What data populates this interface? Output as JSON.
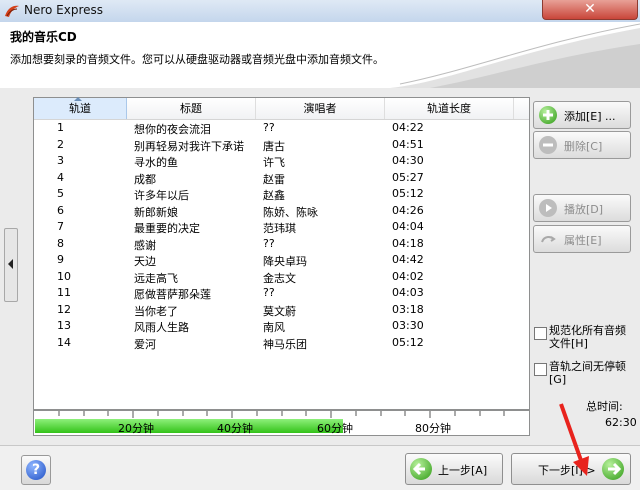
{
  "window": {
    "title": "Nero Express",
    "close_glyph": "✕"
  },
  "header": {
    "title": "我的音乐CD",
    "subtitle": "添加想要刻录的音频文件。您可以从硬盘驱动器或音频光盘中添加音频文件。"
  },
  "track_list": {
    "columns": [
      "轨道",
      "标题",
      "演唱者",
      "轨道长度"
    ],
    "rows": [
      {
        "num": "1",
        "title": "想你的夜会流泪",
        "artist": "??",
        "length": "04:22"
      },
      {
        "num": "2",
        "title": "别再轻易对我许下承诺",
        "artist": "唐古",
        "length": "04:51"
      },
      {
        "num": "3",
        "title": "寻水的鱼",
        "artist": "许飞",
        "length": "04:30"
      },
      {
        "num": "4",
        "title": "成都",
        "artist": "赵雷",
        "length": "05:27"
      },
      {
        "num": "5",
        "title": "许多年以后",
        "artist": "赵鑫",
        "length": "05:12"
      },
      {
        "num": "6",
        "title": "新郎新娘",
        "artist": "陈娇、陈咏",
        "length": "04:26"
      },
      {
        "num": "7",
        "title": "最重要的决定",
        "artist": "范玮琪",
        "length": "04:04"
      },
      {
        "num": "8",
        "title": "感谢",
        "artist": "??",
        "length": "04:18"
      },
      {
        "num": "9",
        "title": "天边",
        "artist": "降央卓玛",
        "length": "04:42"
      },
      {
        "num": "10",
        "title": "远走高飞",
        "artist": "金志文",
        "length": "04:02"
      },
      {
        "num": "11",
        "title": "愿做菩萨那朵莲",
        "artist": "??",
        "length": "04:03"
      },
      {
        "num": "12",
        "title": "当你老了",
        "artist": "莫文蔚",
        "length": "03:18"
      },
      {
        "num": "13",
        "title": "风雨人生路",
        "artist": "南风",
        "length": "03:30"
      },
      {
        "num": "14",
        "title": "爱河",
        "artist": "神马乐团",
        "length": "05:12"
      }
    ]
  },
  "buttons": {
    "add": "添加[E] ...",
    "delete": "删除[C]",
    "play": "播放[D]",
    "properties": "属性[E]"
  },
  "options": {
    "normalize": {
      "line1": "规范化所有音频",
      "line2": "文件[H]",
      "checked": false
    },
    "no_pause": {
      "line1": "音轨之间无停顿",
      "line2": "[G]",
      "checked": false
    }
  },
  "timeline": {
    "labels": [
      "20分钟",
      "40分钟",
      "60分钟",
      "80分钟"
    ],
    "filled_minutes": 62.5,
    "max_minutes": 100
  },
  "total": {
    "label": "总时间:",
    "value": "62:30"
  },
  "footer": {
    "help": "?",
    "back": "上一步[A]",
    "next": "下一步[I] >"
  },
  "colors": {
    "accent_green": "#33c218",
    "close_red": "#c9463a",
    "arrow_red": "#e8231d"
  },
  "icons": [
    "nero-logo-icon",
    "add-icon",
    "delete-icon",
    "play-icon",
    "properties-icon",
    "help-icon",
    "back-arrow-icon",
    "next-arrow-icon",
    "collapse-left-icon"
  ]
}
